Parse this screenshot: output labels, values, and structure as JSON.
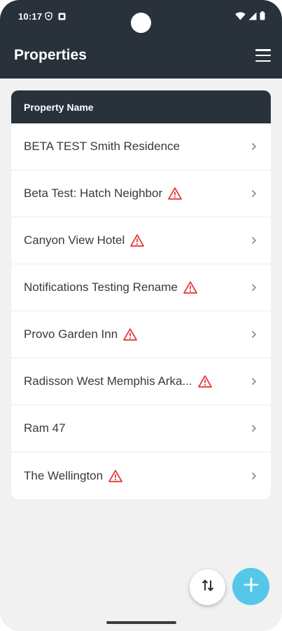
{
  "status_bar": {
    "time": "10:17"
  },
  "app_bar": {
    "title": "Properties",
    "menu_icon": "hamburger-menu-icon"
  },
  "table": {
    "header": "Property Name",
    "rows": [
      {
        "label": "BETA TEST Smith Residence",
        "warning": false
      },
      {
        "label": "Beta Test: Hatch Neighbor",
        "warning": true
      },
      {
        "label": "Canyon View Hotel",
        "warning": true
      },
      {
        "label": "Notifications Testing Rename",
        "warning": true
      },
      {
        "label": "Provo Garden Inn",
        "warning": true
      },
      {
        "label": "Radisson West Memphis Arka...",
        "warning": true
      },
      {
        "label": "Ram 47",
        "warning": false
      },
      {
        "label": "The Wellington",
        "warning": true
      }
    ]
  },
  "fabs": {
    "sort_icon": "sort-arrows-icon",
    "add_icon": "plus-icon"
  },
  "colors": {
    "header_bg": "#29313b",
    "page_bg": "#f1f1f2",
    "warning": "#e53935",
    "accent": "#55c8ea",
    "chevron": "#8a8a8a"
  }
}
